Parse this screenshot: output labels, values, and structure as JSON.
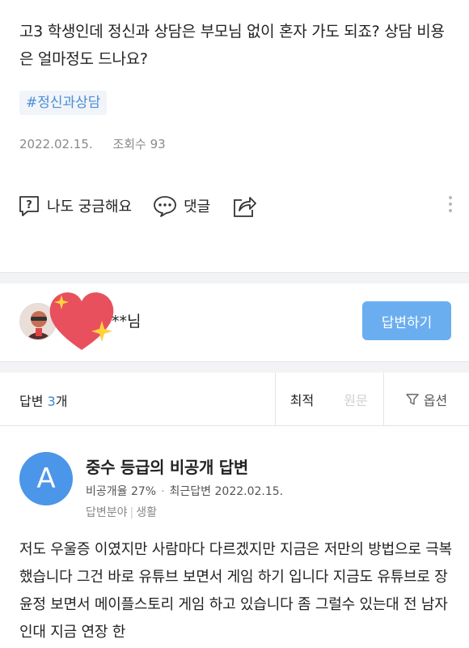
{
  "question": {
    "text": "고3 학생인데 정신과 상담은 부모님 없이 혼자 가도 되죠? 상담 비용은 얼마정도 드나요?",
    "tag": "#정신과상담",
    "date": "2022.02.15.",
    "views": "조회수 93"
  },
  "actions": {
    "curious_label": "나도 궁금해요",
    "comment_label": "댓글"
  },
  "profile": {
    "name": "**님",
    "answer_button": "답변하기"
  },
  "sort_bar": {
    "count_prefix": "답변 ",
    "count_num": "3",
    "count_suffix": "개",
    "latest": "최적",
    "original": "원문",
    "options": "옵션"
  },
  "answer": {
    "avatar_letter": "A",
    "title": "중수 등급의 비공개 답변",
    "adoption": "비공개율 27%",
    "recent": "최근답변 2022.02.15.",
    "field_label": "답변분야",
    "field_value": "생활",
    "body": "저도 우울증 이였지만 사람마다 다르겠지만 지금은 저만의 방법으로 극복 했습니다 그건 바로 유튜브 보면서 게임 하기 입니다 지금도 유튜브로 장윤정 보면서 메이플스토리 게임 하고 있습니다 좀 그럴수 있는대 전 남자 인대 지금 연장 한"
  },
  "colors": {
    "accent": "#6aaef0",
    "link": "#4a8ed8",
    "avatar_bg": "#4b96e8",
    "muted": "#8a8a8a"
  }
}
